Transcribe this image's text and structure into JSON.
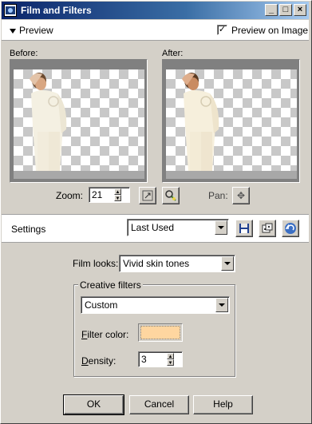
{
  "window": {
    "title": "Film and Filters",
    "controls": [
      "_",
      "□",
      "×"
    ]
  },
  "preview": {
    "toggle_label": "Preview",
    "preview_on_image_label": "Preview on Image",
    "preview_on_image_checked": true,
    "before_label": "Before:",
    "after_label": "After:"
  },
  "zoom": {
    "label": "Zoom:",
    "value": "21",
    "pan_label": "Pan:"
  },
  "settings": {
    "label": "Settings",
    "preset": "Last Used"
  },
  "film_looks": {
    "label": "Film looks:",
    "value": "Vivid skin tones"
  },
  "creative_filters": {
    "group_label": "Creative filters",
    "filter": "Custom",
    "filter_color_label_u": "F",
    "filter_color_label_rest": "ilter color:",
    "filter_color": "#ffd6a0",
    "density_label_u": "D",
    "density_label_rest": "ensity:",
    "density_value": "3"
  },
  "buttons": {
    "ok": "OK",
    "cancel": "Cancel",
    "help": "Help"
  }
}
